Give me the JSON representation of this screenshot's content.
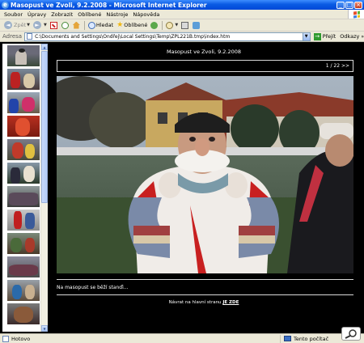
{
  "window": {
    "title": "Masopust ve Zvoli, 9.2.2008 - Microsoft Internet Explorer"
  },
  "menu": {
    "items": [
      "Soubor",
      "Úpravy",
      "Zobrazit",
      "Oblíbené",
      "Nástroje",
      "Nápověda"
    ]
  },
  "toolbar": {
    "back_label": "Zpět",
    "search_label": "Hledat",
    "favorites_label": "Oblíbené"
  },
  "address": {
    "label": "Adresa",
    "value": "C:\\Documents and Settings\\Ondřej\\Local Settings\\Temp\\ZPL221B.tmp\\index.htm",
    "go_label": "Přejít",
    "links_label": "Odkazy"
  },
  "main": {
    "page_title": "Masopust ve Zvoli, 9.2.2008",
    "counter": "1 / 22 >>",
    "caption": "Na masopust se běží stanďi...",
    "back_text": "Návrat na hlavní stranu",
    "back_link": "JE ZDE"
  },
  "status": {
    "left": "Hotovo",
    "zone": "Tento počítač"
  },
  "colors": {
    "titlebar": "#0a5be3",
    "chrome": "#ece9d8",
    "content_bg": "#000000",
    "thumb_bg": "#ffffff"
  }
}
